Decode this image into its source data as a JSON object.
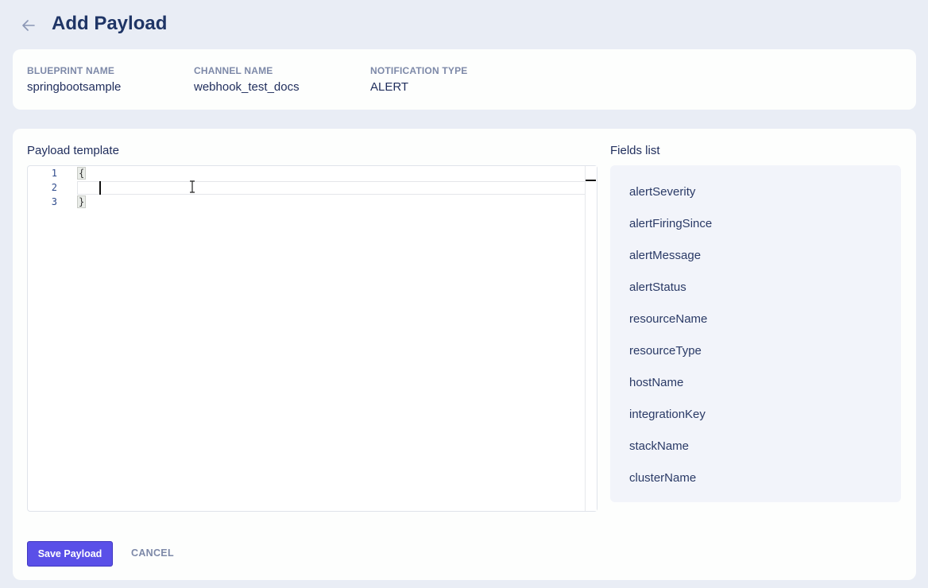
{
  "header": {
    "title": "Add Payload",
    "back_icon": "arrow-left-icon"
  },
  "info": {
    "blueprint_label": "BLUEPRINT NAME",
    "blueprint_value": "springbootsample",
    "channel_label": "CHANNEL NAME",
    "channel_value": "webhook_test_docs",
    "notification_label": "NOTIFICATION TYPE",
    "notification_value": "ALERT"
  },
  "editor": {
    "title": "Payload template",
    "lines": [
      {
        "num": "1",
        "text": "{"
      },
      {
        "num": "2",
        "text": ""
      },
      {
        "num": "3",
        "text": "}"
      }
    ]
  },
  "fields": {
    "title": "Fields list",
    "items": [
      "alertSeverity",
      "alertFiringSince",
      "alertMessage",
      "alertStatus",
      "resourceName",
      "resourceType",
      "hostName",
      "integrationKey",
      "stackName",
      "clusterName"
    ]
  },
  "actions": {
    "save_label": "Save Payload",
    "cancel_label": "CANCEL"
  },
  "colors": {
    "primary": "#5a50e8",
    "background": "#e9edf5",
    "title": "#1f3566"
  }
}
